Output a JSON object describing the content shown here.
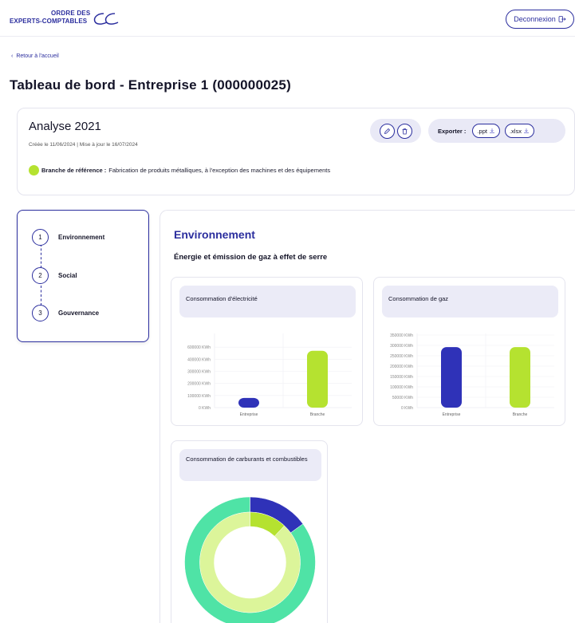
{
  "header": {
    "logo_line1": "ORDRE DES",
    "logo_line2": "EXPERTS-COMPTABLES",
    "logout_label": "Deconnexion"
  },
  "nav": {
    "back_label": "Retour à l'accueil"
  },
  "page": {
    "title": "Tableau de bord - Entreprise 1 (000000025)"
  },
  "analysis": {
    "title": "Analyse 2021",
    "dates": "Créée le 11/06/2024 | Mise à jour le 16/07/2024",
    "export_label": "Exporter :",
    "export_ppt": ".ppt",
    "export_xlsx": ".xlsx",
    "branch_label": "Branche de référence :",
    "branch_value": "Fabrication de produits métalliques, à l'exception des machines et des équipements"
  },
  "steps": [
    {
      "num": "1",
      "label": "Environnement"
    },
    {
      "num": "2",
      "label": "Social"
    },
    {
      "num": "3",
      "label": "Gouvernance"
    }
  ],
  "section": {
    "title": "Environnement",
    "subtitle": "Énergie et émission de gaz à effet de serre"
  },
  "colors": {
    "primary": "#2b2e9e",
    "entreprise": "#2f32b8",
    "branche": "#b5e230",
    "outer_ring": "#4fe3a6",
    "inner_ring": "#dcf59a"
  },
  "chart_data": [
    {
      "type": "bar",
      "title": "Consommation d'électricité",
      "categories": [
        "Entreprise",
        "Branche"
      ],
      "values": [
        80000,
        470000
      ],
      "unit": "KWh",
      "ylim": [
        0,
        600000
      ],
      "yticks": [
        "0 KWh",
        "100000 KWh",
        "200000 KWh",
        "300000 KWh",
        "400000 KWh",
        "600000 KWh"
      ],
      "ytick_values": [
        0,
        100000,
        200000,
        300000,
        400000,
        500000
      ]
    },
    {
      "type": "bar",
      "title": "Consommation de gaz",
      "categories": [
        "Entreprise",
        "Branche"
      ],
      "values": [
        292000,
        292000
      ],
      "unit": "KWh",
      "ylim": [
        0,
        350000
      ],
      "yticks": [
        "0 KWh",
        "50000 KWh",
        "100000 KWh",
        "150000 KWh",
        "200000 KWh",
        "250000 KWh",
        "300000 KWh",
        "350000 KWh"
      ],
      "ytick_values": [
        0,
        50000,
        100000,
        150000,
        200000,
        250000,
        300000,
        350000
      ]
    },
    {
      "type": "pie",
      "title": "Consommation de carburants et combustibles",
      "series": [
        {
          "name": "outer",
          "values": [
            15,
            85
          ]
        },
        {
          "name": "inner",
          "values": [
            12,
            88
          ]
        }
      ]
    }
  ]
}
